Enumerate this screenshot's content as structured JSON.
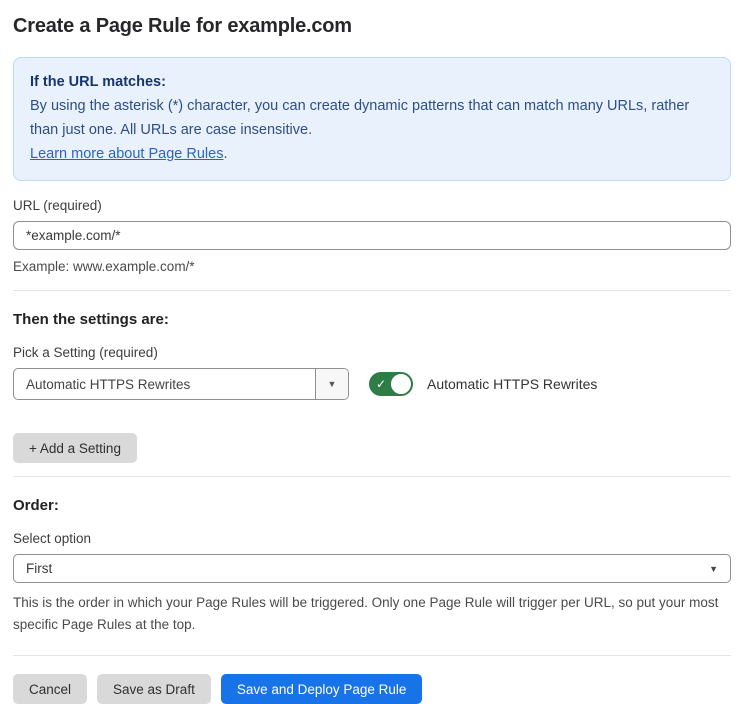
{
  "page": {
    "title": "Create a Page Rule for example.com"
  },
  "info_box": {
    "heading": "If the URL matches:",
    "body": "By using the asterisk (*) character, you can create dynamic patterns that can match many URLs, rather than just one. All URLs are case insensitive.",
    "link_label": "Learn more about Page Rules",
    "link_suffix": "."
  },
  "url_field": {
    "label": "URL (required)",
    "value": "*example.com/*",
    "helper": "Example: www.example.com/*"
  },
  "settings_section": {
    "heading": "Then the settings are:",
    "picker_label": "Pick a Setting (required)",
    "picker_value": "Automatic HTTPS Rewrites",
    "toggle_state": "on",
    "toggle_label": "Automatic HTTPS Rewrites",
    "add_setting_label": "+ Add a Setting"
  },
  "order_section": {
    "heading": "Order:",
    "select_label": "Select option",
    "select_value": "First",
    "helper": "This is the order in which your Page Rules will be triggered. Only one Page Rule will trigger per URL, so put your most specific Page Rules at the top."
  },
  "footer": {
    "cancel_label": "Cancel",
    "save_draft_label": "Save as Draft",
    "save_deploy_label": "Save and Deploy Page Rule"
  },
  "colors": {
    "info_bg": "#e9f2fc",
    "info_border": "#bcd9f5",
    "info_heading_text": "#16356e",
    "info_body_text": "#2d4e85",
    "link_blue": "#2c62c7",
    "toggle_green": "#2e7d46",
    "primary_blue": "#1873e8",
    "button_gray": "#d9d9d9"
  },
  "icons": {
    "dropdown_arrow": "▼",
    "select_arrow": "▼",
    "toggle_check": "✓"
  }
}
